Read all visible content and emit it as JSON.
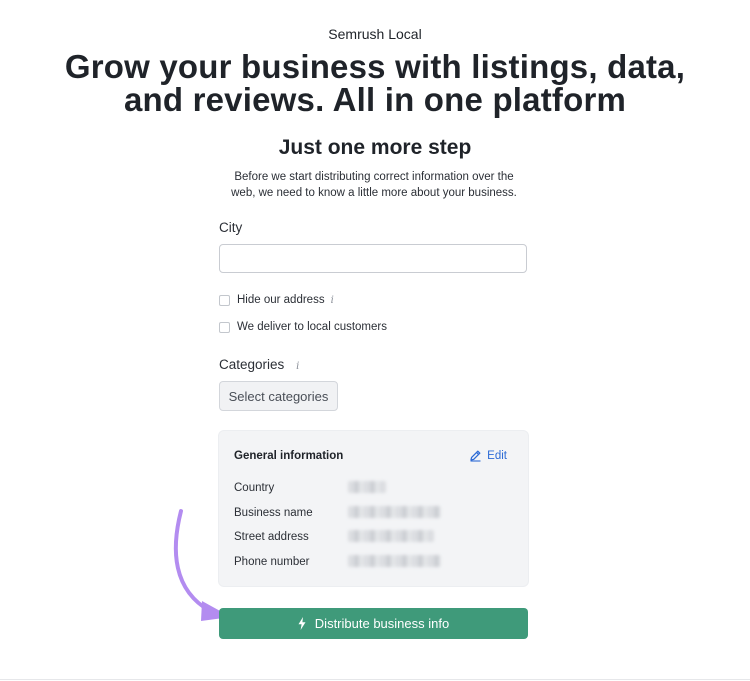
{
  "header": {
    "eyebrow": "Semrush Local",
    "headline_line1": "Grow your business with listings, data,",
    "headline_line2": "and reviews. All in one platform"
  },
  "step": {
    "title": "Just one more step",
    "intro_line1": "Before we start distributing correct information over the",
    "intro_line2": "web, we need to know a little more about your business."
  },
  "form": {
    "city_label": "City",
    "city_value": "",
    "city_placeholder": "",
    "hide_address_label": "Hide our address",
    "hide_address_checked": false,
    "deliver_label": "We deliver to local customers",
    "deliver_checked": false,
    "categories_label": "Categories",
    "categories_button": "Select categories"
  },
  "general_info": {
    "title": "General information",
    "edit_label": "Edit",
    "rows": [
      {
        "label": "Country"
      },
      {
        "label": "Business name"
      },
      {
        "label": "Street address"
      },
      {
        "label": "Phone number"
      }
    ]
  },
  "actions": {
    "distribute_label": "Distribute business info"
  },
  "colors": {
    "primary_green": "#3f9a7a",
    "link_blue": "#2d6bd6",
    "arrow_purple": "#b38cf0",
    "card_bg": "#f3f4f6"
  },
  "icons": {
    "info": "info-icon",
    "edit": "pencil-icon",
    "distribute": "lightning-bolt-icon",
    "annotation": "curved-arrow"
  }
}
